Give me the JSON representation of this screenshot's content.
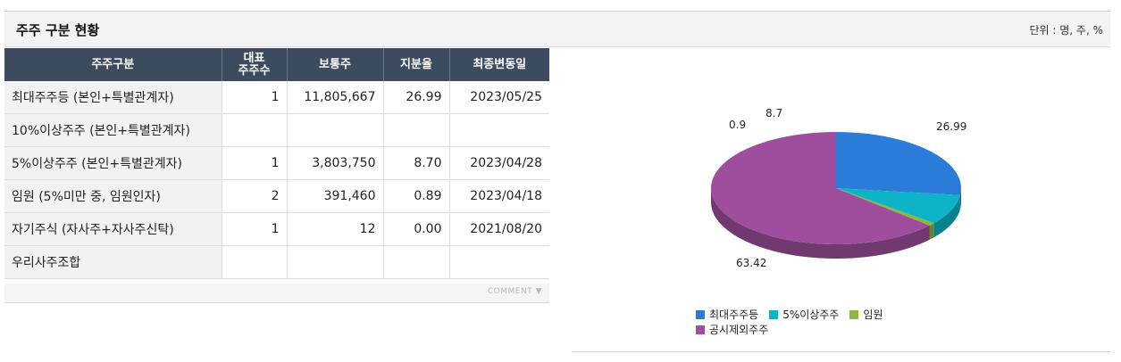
{
  "section": {
    "title": "주주 구분 현황",
    "unit_text": "단위 : 명, 주, %"
  },
  "table": {
    "headers": [
      "주주구분",
      "대표\n주주수",
      "보통주",
      "지분율",
      "최종변동일"
    ],
    "rows": [
      [
        "최대주주등 (본인+특별관계자)",
        "1",
        "11,805,667",
        "26.99",
        "2023/05/25"
      ],
      [
        "10%이상주주 (본인+특별관계자)",
        "",
        "",
        "",
        ""
      ],
      [
        "5%이상주주 (본인+특별관계자)",
        "1",
        "3,803,750",
        "8.70",
        "2023/04/28"
      ],
      [
        "임원 (5%미만 중, 임원인자)",
        "2",
        "391,460",
        "0.89",
        "2023/04/18"
      ],
      [
        "자기주식 (자사주+자사주신탁)",
        "1",
        "12",
        "0.00",
        "2021/08/20"
      ],
      [
        "우리사주조합",
        "",
        "",
        "",
        ""
      ]
    ]
  },
  "comment_label": "COMMENT",
  "colors": {
    "largest": "#2b7bd8",
    "five_pct": "#0db4c8",
    "officers": "#8cb93c",
    "others": "#9e4e9c"
  },
  "chart_data": {
    "type": "pie",
    "slices": [
      {
        "name": "최대주주등",
        "value": 26.99,
        "label": "26.99",
        "color": "#2b7bd8"
      },
      {
        "name": "5%이상주주",
        "value": 8.7,
        "label": "8.7",
        "color": "#0db4c8"
      },
      {
        "name": "임원",
        "value": 0.9,
        "label": "0.9",
        "color": "#8cb93c"
      },
      {
        "name": "공시제외주주",
        "value": 63.42,
        "label": "63.42",
        "color": "#9e4e9c"
      }
    ],
    "legend_position": "bottom",
    "legend": [
      "최대주주등",
      "5%이상주주",
      "임원",
      "공시제외주주"
    ]
  }
}
